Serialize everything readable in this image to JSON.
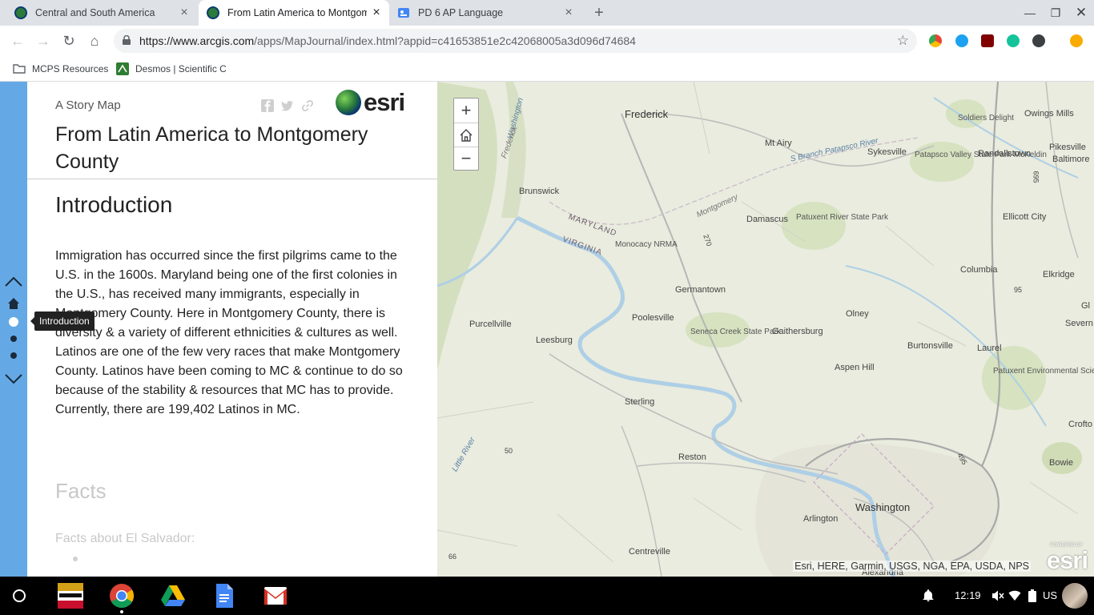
{
  "browser": {
    "tabs": [
      {
        "title": "Central and South America",
        "active": false
      },
      {
        "title": "From Latin America to Montgom",
        "active": true
      },
      {
        "title": "PD 6 AP Language",
        "active": false
      }
    ],
    "new_tab": "+",
    "url": {
      "host": "https://www.arcgis.com",
      "path": "/apps/MapJournal/index.html?appid=c41653851e2c42068005a3d096d74684"
    },
    "bookmarks": [
      {
        "label": "MCPS Resources"
      },
      {
        "label": "Desmos | Scientific C"
      }
    ],
    "colors": {
      "tab_strip": "#dee1e6",
      "omnibox": "#f1f3f4"
    }
  },
  "story": {
    "subtitle": "A Story Map",
    "logo_text": "esri",
    "title": "From Latin America to Montgomery County",
    "tooltip": "Introduction",
    "sections": [
      {
        "title": "Introduction",
        "body": "Immigration has occurred since the first pilgrims came to the U.S. in the 1600s. Maryland being one of the first colonies in the U.S., has received many immigrants, especially in Montgomery County. Here in Montgomery County, there is diversity & a variety of different ethnicities & cultures as well. Latinos are one of the few very races that make Montgomery County. Latinos have been coming to MC & continue to do so because of the stability & resources that MC has to provide. Currently, there are 199,402 Latinos in MC."
      },
      {
        "title": "Facts",
        "body": "Facts about El Salvador:"
      }
    ],
    "colors": {
      "sidenav": "#64a9e6",
      "faded_text": "#c8c8c8"
    }
  },
  "map": {
    "zoom_in": "+",
    "zoom_out": "−",
    "labels": {
      "frederick": "Frederick",
      "mt_airy": "Mt Airy",
      "sykesville": "Sykesville",
      "soldiers_delight": "Soldiers Delight",
      "owings_mills": "Owings Mills",
      "randallstown": "Randallstown",
      "pikesville": "Pikesville",
      "baltimore": "Baltimore",
      "patapsco": "Patapsco Valley State Park-McKeldin",
      "brunswick": "Brunswick",
      "damascus": "Damascus",
      "patuxent_river": "Patuxent River State Park",
      "ellicott": "Ellicott City",
      "columbia": "Columbia",
      "elkridge": "Elkridge",
      "maryland": "MARYLAND",
      "virginia": "VIRGINIA",
      "monocacy": "Monocacy NRMA",
      "germantown": "Germantown",
      "poolesville": "Poolesville",
      "purcellville": "Purcellville",
      "leesburg": "Leesburg",
      "seneca": "Seneca Creek State Park",
      "gaithersburg": "Gaithersburg",
      "olney": "Olney",
      "burtonsville": "Burtonsville",
      "laurel": "Laurel",
      "aspen_hill": "Aspen Hill",
      "patuxent_env": "Patuxent Environmental Science Center",
      "sterling": "Sterling",
      "reston": "Reston",
      "bowie": "Bowie",
      "washington": "Washington",
      "arlington": "Arlington",
      "centreville": "Centreville",
      "alexandria": "Alexandria",
      "crofton": "Crofto",
      "severn": "Severn",
      "gl": "Gl",
      "montgomery": "Montgomery",
      "washington_county": "Washington",
      "frederick_county": "Frederick",
      "branch_patapsco": "S Branch Patapsco River",
      "little_river": "Little River",
      "r270": "270",
      "r495": "495",
      "r95": "95",
      "r695": "695",
      "r66": "66",
      "r50": "50"
    },
    "attribution": "Esri, HERE, Garmin, USGS, NGA, EPA, USDA, NPS",
    "logo_text": "esri",
    "logo_caption": "POWERED BY",
    "colors": {
      "land": "#e9ecde",
      "water": "#aecfe6",
      "parks": "#cfdcb6"
    }
  },
  "taskbar": {
    "time": "12:19",
    "locale": "US",
    "apps": [
      "md-education-app",
      "chrome-app",
      "drive-app",
      "docs-app",
      "gmail-app"
    ]
  }
}
